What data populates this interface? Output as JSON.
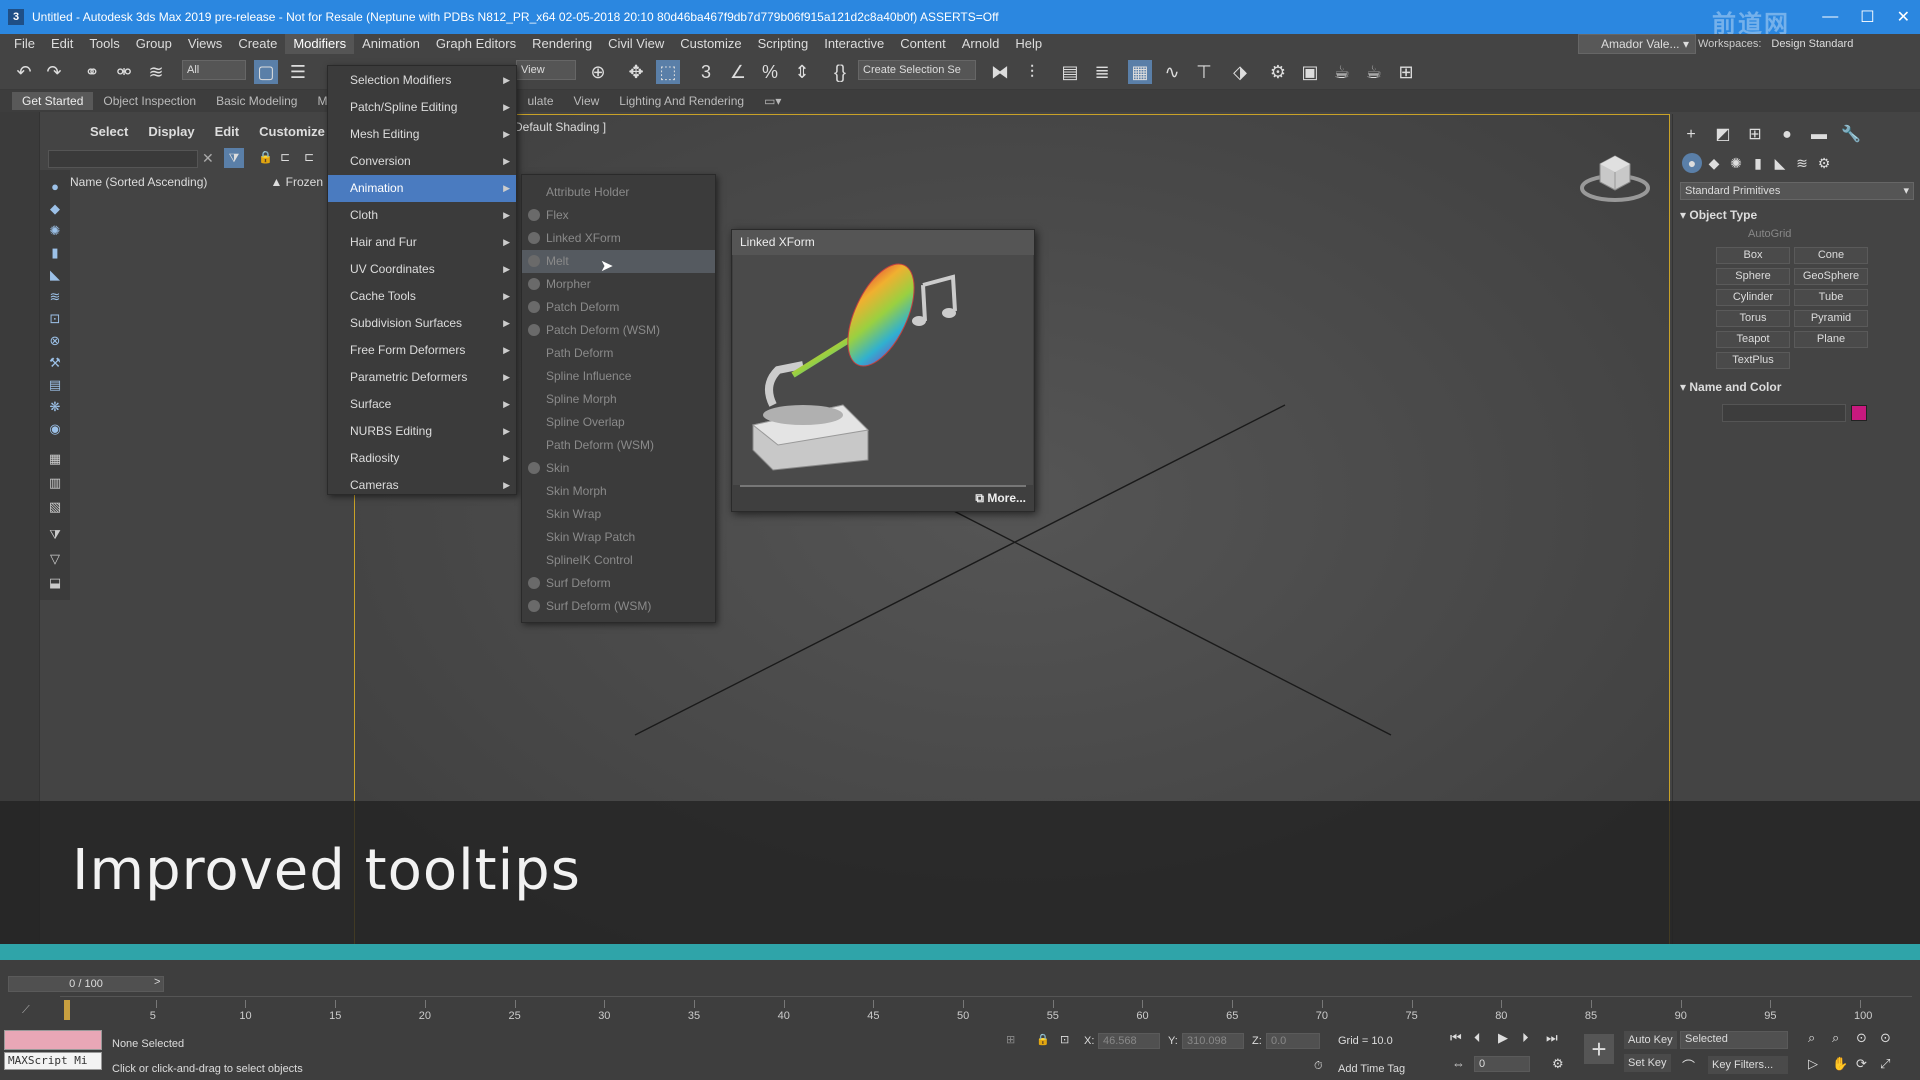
{
  "window": {
    "title": "Untitled - Autodesk 3ds Max 2019 pre-release - Not for Resale (Neptune with PDBs N812_PR_x64 02-05-2018 20:10 80d46ba467f9db7d779b06f915a121d2c8a40b0f) ASSERTS=Off",
    "app_icon": "3",
    "watermark": "前道网",
    "controls": [
      "—",
      "☐",
      "✕"
    ]
  },
  "menubar": {
    "items": [
      "File",
      "Edit",
      "Tools",
      "Group",
      "Views",
      "Create",
      "Modifiers",
      "Animation",
      "Graph Editors",
      "Rendering",
      "Civil View",
      "Customize",
      "Scripting",
      "Interactive",
      "Content",
      "Arnold",
      "Help"
    ],
    "active_index": 6,
    "user": "Amador Vale...",
    "workspaces_label": "Workspaces:",
    "workspace_value": "Design Standard"
  },
  "toolbar": {
    "filter_value": "All",
    "view_value": "View",
    "create_selection": "Create Selection Se"
  },
  "ribbon": {
    "tabs": [
      "Get Started",
      "Object Inspection",
      "Basic Modeling",
      "M",
      "ulate",
      "View",
      "Lighting And Rendering"
    ]
  },
  "explorer": {
    "tabs": [
      "Select",
      "Display",
      "Edit",
      "Customize"
    ],
    "column_name": "Name (Sorted Ascending)",
    "column_frozen": "▲ Frozen"
  },
  "viewport": {
    "label": "Default Shading ]"
  },
  "modifiers_menu": {
    "items": [
      {
        "label": "Selection Modifiers",
        "underline": "S"
      },
      {
        "label": "Patch/Spline Editing",
        "underline": "P"
      },
      {
        "label": "Mesh Editing",
        "underline": "M"
      },
      {
        "label": "Conversion",
        "underline": "C"
      },
      {
        "label": "Animation",
        "underline": "A"
      },
      {
        "label": "Cloth",
        "underline": ""
      },
      {
        "label": "Hair and Fur",
        "underline": ""
      },
      {
        "label": "UV Coordinates",
        "underline": "U"
      },
      {
        "label": "Cache Tools",
        "underline": ""
      },
      {
        "label": "Subdivision Surfaces",
        "underline": ""
      },
      {
        "label": "Free Form Deformers",
        "underline": "F"
      },
      {
        "label": "Parametric Deformers",
        "underline": "a"
      },
      {
        "label": "Surface",
        "underline": ""
      },
      {
        "label": "NURBS Editing",
        "underline": "N"
      },
      {
        "label": "Radiosity",
        "underline": "R"
      },
      {
        "label": "Cameras",
        "underline": ""
      }
    ],
    "highlight_index": 4
  },
  "animation_menu": {
    "items": [
      "Attribute Holder",
      "Flex",
      "Linked XForm",
      "Melt",
      "Morpher",
      "Patch Deform",
      "Patch Deform (WSM)",
      "Path Deform",
      "Spline Influence",
      "Spline Morph",
      "Spline Overlap",
      "Path Deform (WSM)",
      "Skin",
      "Skin Morph",
      "Skin Wrap",
      "Skin Wrap Patch",
      "SplineIK Control",
      "Surf Deform",
      "Surf Deform (WSM)"
    ],
    "hover_index": 3
  },
  "tooltip": {
    "title": "Linked XForm",
    "more": "More..."
  },
  "caption": "Improved tooltips",
  "command_panel": {
    "category": "Standard Primitives",
    "object_type_title": "Object Type",
    "autogrid": "AutoGrid",
    "buttons": [
      "Box",
      "Cone",
      "Sphere",
      "GeoSphere",
      "Cylinder",
      "Tube",
      "Torus",
      "Pyramid",
      "Teapot",
      "Plane",
      "TextPlus"
    ],
    "name_color_title": "Name and Color",
    "swatch_color": "#c8197e"
  },
  "timeline": {
    "frame_display": "0 / 100",
    "ticks": [
      "5",
      "10",
      "15",
      "20",
      "25",
      "30",
      "35",
      "40",
      "45",
      "50",
      "55",
      "60",
      "65",
      "70",
      "75",
      "80",
      "85",
      "90",
      "95",
      "100"
    ]
  },
  "status": {
    "maxscript": "MAXScript Mi",
    "selection": "None Selected",
    "prompt": "Click or click-and-drag to select objects",
    "x_label": "X:",
    "x_value": "46.568",
    "y_label": "Y:",
    "y_value": "310.098",
    "z_label": "Z:",
    "z_value": "0.0",
    "grid": "Grid = 10.0",
    "add_time_tag": "Add Time Tag",
    "auto_key": "Auto Key",
    "set_key": "Set Key",
    "selected": "Selected",
    "key_filters": "Key Filters...",
    "frame": "0"
  }
}
